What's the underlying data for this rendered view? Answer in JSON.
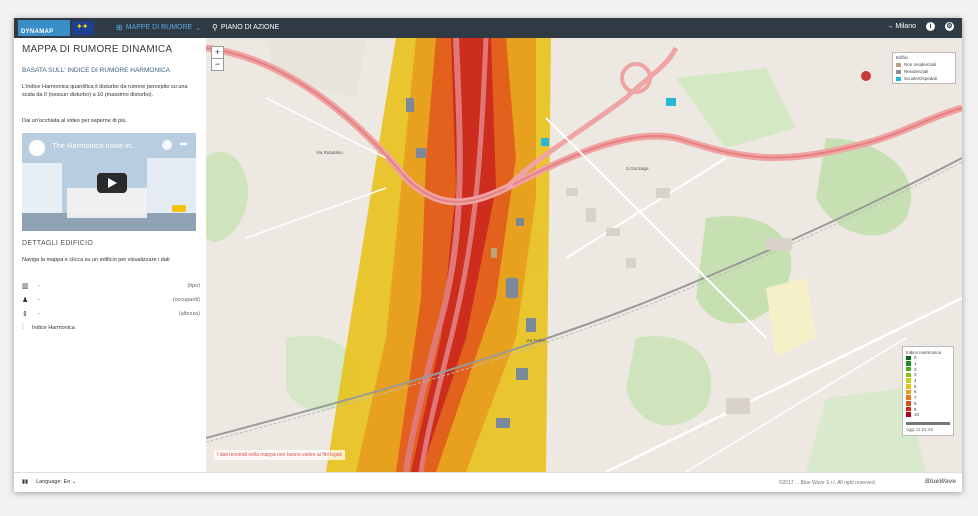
{
  "header": {
    "logo_text": "DYNAMAP",
    "eu_flag": "eu-flag-icon",
    "nav": [
      {
        "label": "MAPPE DI RUMORE",
        "icon": "map-icon",
        "active": true
      },
      {
        "label": "PIANO DI AZIONE",
        "icon": "filter-icon",
        "active": false
      }
    ],
    "city_link": "→ Milano",
    "info_icon": "info-icon",
    "settings_icon": "gear-icon"
  },
  "sidebar": {
    "title": "MAPPA DI RUMORE DINAMICA",
    "subtitle": "BASATA SULL' INDICE DI RUMORE HARMONICA",
    "description": "L'indice Harmonica quantifica il disturbo da rumore percepito su una scala da 0 (nessun disturbo) a 10 (massimo disturbo).",
    "video_hint": "Dai un'occhiata al video per saperne di più.",
    "video": {
      "title": "The Harmonica noise in...",
      "play_icon": "play-icon"
    },
    "details_heading": "DETTAGLI EDIFICIO",
    "details_hint": "Naviga la mappa e clicca su un edificio per visualizzare i dati",
    "details_rows": [
      {
        "icon": "building-icon",
        "value": "-",
        "unit": "(tipo)"
      },
      {
        "icon": "people-icon",
        "value": "-",
        "unit": "(occupanti)"
      },
      {
        "icon": "height-icon",
        "value": "-",
        "unit": "(altezza)"
      }
    ],
    "harmonica_label": "Indice Harmonica"
  },
  "map": {
    "zoom_in": "+",
    "zoom_out": "−",
    "legend_buildings": {
      "title": "Edifici",
      "items": [
        {
          "label": "Non residenziali",
          "color": "#b9a47a"
        },
        {
          "label": "Residenziali",
          "color": "#8a8f96"
        },
        {
          "label": "Scuole/Ospedali",
          "color": "#27b7d6"
        }
      ]
    },
    "legend_noise": {
      "title": "Indice Harmonica",
      "levels": [
        {
          "label": "0",
          "color": "#006b1f"
        },
        {
          "label": "1",
          "color": "#1f8a1f"
        },
        {
          "label": "2",
          "color": "#4da81f"
        },
        {
          "label": "3",
          "color": "#86c21a"
        },
        {
          "label": "4",
          "color": "#c4d21a"
        },
        {
          "label": "5",
          "color": "#e3c21a"
        },
        {
          "label": "6",
          "color": "#e6a21a"
        },
        {
          "label": "7",
          "color": "#e57c1a"
        },
        {
          "label": "8",
          "color": "#e0501a"
        },
        {
          "label": "9",
          "color": "#d2261a"
        },
        {
          "label": "10",
          "color": "#b5001a"
        }
      ],
      "timestamp": "oggi 11:51:46"
    },
    "disclaimer": "I dati mostrati nella mappa non hanno valore ai fini legali",
    "places": [
      "Via Rubattino",
      "S.Gonzaga",
      "Via Feltre"
    ]
  },
  "footer": {
    "left_icon": "menu-icon",
    "language": "Language: En",
    "copyright": "©2017 ... Blue Wave S.r.l. All right reserved.",
    "brand": "BlueWave"
  }
}
